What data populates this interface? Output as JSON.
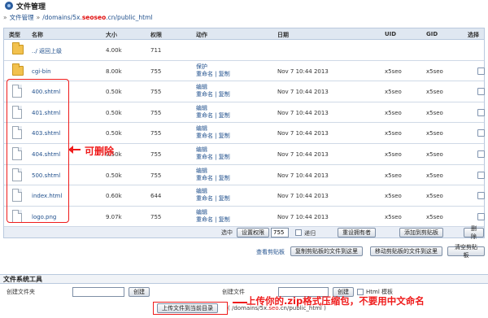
{
  "window": {
    "title": "文件管理"
  },
  "breadcrumb": {
    "root": "文件管理",
    "path_prefix": "/domains/5x.",
    "path_redacted": "seoseo",
    "path_suffix": ".cn/public_html"
  },
  "table": {
    "headers": {
      "type": "类型",
      "name": "名称",
      "size": "大小",
      "perm": "权限",
      "action": "动作",
      "date": "日期",
      "uid": "UID",
      "gid": "GID",
      "select": "选择"
    },
    "rows": [
      {
        "icon": "folder-icon",
        "name": "../ 返回上级",
        "size": "4.00k",
        "perm": "711",
        "actions": [],
        "date": "",
        "uid": "",
        "gid": "",
        "selectable": false
      },
      {
        "icon": "folder-icon",
        "name": "cgi-bin",
        "size": "8.00k",
        "perm": "755",
        "actions": [
          "保护",
          "重命名 | 复制"
        ],
        "date": "Nov 7 10:44 2013",
        "uid": "x5seo",
        "gid": "x5seo",
        "selectable": true
      },
      {
        "icon": "file-icon",
        "name": "400.shtml",
        "size": "0.50k",
        "perm": "755",
        "actions": [
          "编辑",
          "重命名 | 复制"
        ],
        "date": "Nov 7 10:44 2013",
        "uid": "x5seo",
        "gid": "x5seo",
        "selectable": true
      },
      {
        "icon": "file-icon",
        "name": "401.shtml",
        "size": "0.50k",
        "perm": "755",
        "actions": [
          "编辑",
          "重命名 | 复制"
        ],
        "date": "Nov 7 10:44 2013",
        "uid": "x5seo",
        "gid": "x5seo",
        "selectable": true
      },
      {
        "icon": "file-icon",
        "name": "403.shtml",
        "size": "0.50k",
        "perm": "755",
        "actions": [
          "编辑",
          "重命名 | 复制"
        ],
        "date": "Nov 7 10:44 2013",
        "uid": "x5seo",
        "gid": "x5seo",
        "selectable": true
      },
      {
        "icon": "file-icon",
        "name": "404.shtml",
        "size": "0.50k",
        "perm": "755",
        "actions": [
          "编辑",
          "重命名 | 复制"
        ],
        "date": "Nov 7 10:44 2013",
        "uid": "x5seo",
        "gid": "x5seo",
        "selectable": true
      },
      {
        "icon": "file-icon",
        "name": "500.shtml",
        "size": "0.50k",
        "perm": "755",
        "actions": [
          "编辑",
          "重命名 | 复制"
        ],
        "date": "Nov 7 10:44 2013",
        "uid": "x5seo",
        "gid": "x5seo",
        "selectable": true
      },
      {
        "icon": "file-icon",
        "name": "index.html",
        "size": "0.60k",
        "perm": "644",
        "actions": [
          "编辑",
          "重命名 | 复制"
        ],
        "date": "Nov 7 10:44 2013",
        "uid": "x5seo",
        "gid": "x5seo",
        "selectable": true
      },
      {
        "icon": "file-icon",
        "name": "logo.png",
        "size": "9.07k",
        "perm": "755",
        "actions": [
          "编辑",
          "重命名 | 复制"
        ],
        "date": "Nov 7 10:44 2013",
        "uid": "x5seo",
        "gid": "x5seo",
        "selectable": true
      }
    ]
  },
  "annotation_delete": "可删除",
  "toolbar1": {
    "selected_label": "选中",
    "set_perm_button": "设置权限",
    "perm_value": "755",
    "recursive_label": "递归",
    "reset_owner_button": "重设拥有者",
    "add_clipboard_button": "添加到剪贴板",
    "delete_button": "删除"
  },
  "toolbar2": {
    "view_clipboard_link": "查看剪贴板",
    "copy_here_button": "复制剪贴板的文件到这里",
    "move_here_button": "移动剪贴板的文件到这里",
    "clear_clipboard_button": "清空剪贴板"
  },
  "filesystem": {
    "title": "文件系统工具",
    "create_folder_label": "创建文件夹",
    "create_folder_button": "创建",
    "create_file_label": "创建文件",
    "create_file_button": "创建",
    "html_template_label": "Html 模板",
    "upload_button": "上传文件到当前目录",
    "upload_path_prefix": "( /domains/5x.",
    "upload_path_suffix": ".cn/public_html )"
  },
  "annotation_upload": "上传你的.zip格式压缩包，不要用中文命名",
  "colors": {
    "accent": "#1f4f8c",
    "annotation": "#ef1b1b",
    "header_bg": "#dfe7f1"
  }
}
